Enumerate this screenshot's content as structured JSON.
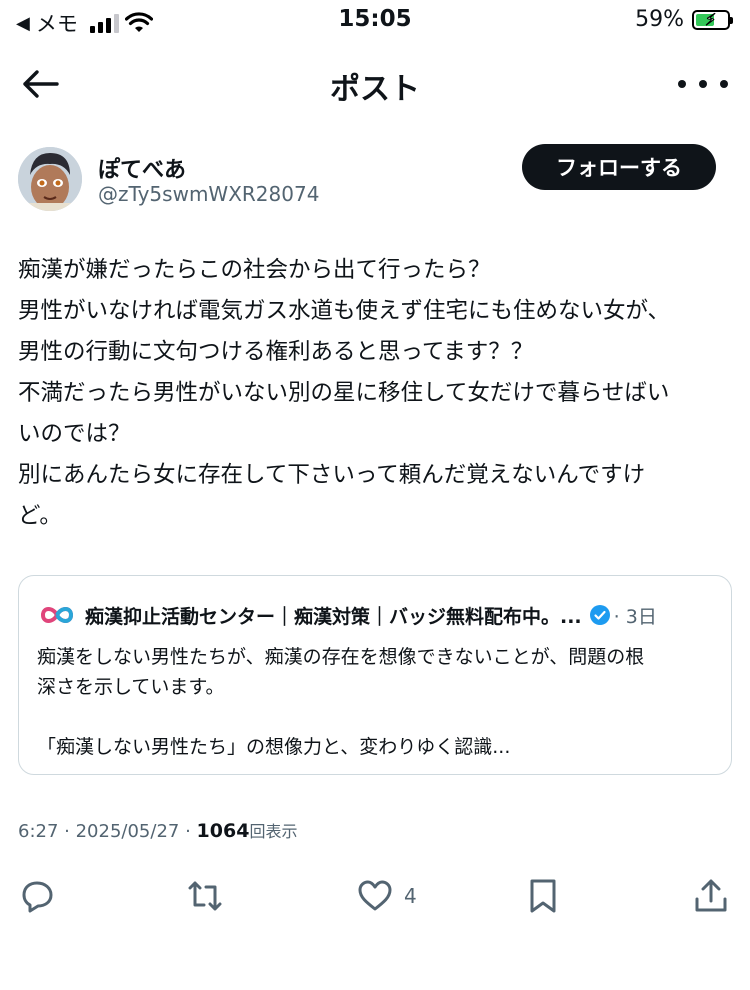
{
  "status_bar": {
    "back_app_label": "メモ",
    "time": "15:05",
    "battery_percent": "59%",
    "battery_level": 0.59
  },
  "header": {
    "title": "ポスト"
  },
  "author": {
    "display_name": "ぽてべあ",
    "handle": "@zTy5swmWXR28074",
    "follow_label": "フォローする"
  },
  "tweet": {
    "lines": [
      "痴漢が嫌だったらこの社会から出て行ったら？",
      "男性がいなければ電気ガス水道も使えず住宅にも住めない女が、",
      "男性の行動に文句つける権利あると思ってます？？",
      "不満だったら男性がいない別の星に移住して女だけで暮らせばい",
      "いのでは？",
      "別にあんたら女に存在して下さいって頼んだ覚えないんですけ",
      "ど。"
    ]
  },
  "quote": {
    "account_name": "痴漢抑止活動センター｜痴漢対策｜バッジ無料配布中。...",
    "date": "· 3日",
    "text_line1": "痴漢をしない男性たちが、痴漢の存在を想像できないことが、問題の根",
    "text_line2": "深さを示しています。",
    "text_line3": "「痴漢しない男性たち」の想像力と、変わりゆく認識..."
  },
  "meta": {
    "time": "6:27",
    "date": "2025/05/27",
    "views": "1064",
    "views_label": "回表示"
  },
  "actions": {
    "like_count": "4"
  }
}
